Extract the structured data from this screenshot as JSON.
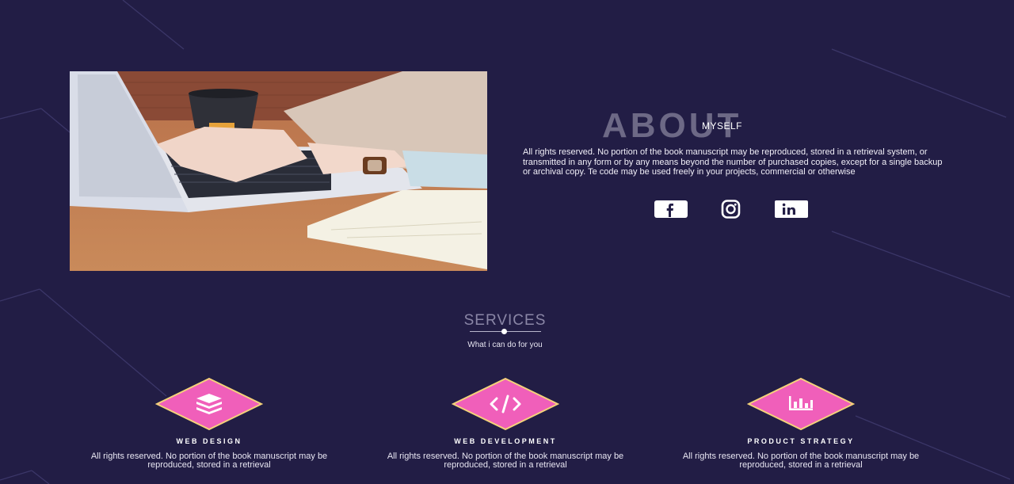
{
  "about": {
    "title": "ABOUT",
    "subtitle": "MYSELF",
    "text": "All rights reserved. No portion of the book manuscript may be reproduced, stored in a retrieval system, or transmitted in any form or by any means beyond the number of purchased copies, except for a single backup or archival copy. Te code may be used freely in your projects, commercial or otherwise"
  },
  "social": [
    {
      "name": "facebook-icon"
    },
    {
      "name": "instagram-icon"
    },
    {
      "name": "linkedin-icon"
    }
  ],
  "services": {
    "title": "SERVICES",
    "subtitle": "What i can do for you",
    "items": [
      {
        "name": "WEB DESIGN",
        "icon": "layers-icon",
        "desc": "All rights reserved. No portion of the book manuscript may be reproduced, stored in a retrieval"
      },
      {
        "name": "WEB DEVELOPMENT",
        "icon": "code-icon",
        "desc": "All rights reserved. No portion of the book manuscript may be reproduced, stored in a retrieval"
      },
      {
        "name": "PRODUCT STRATEGY",
        "icon": "chart-icon",
        "desc": "All rights reserved. No portion of the book manuscript may be reproduced, stored in a retrieval"
      }
    ]
  },
  "colors": {
    "background": "#221d45",
    "accent": "#f05fba",
    "accent_border": "#f4d27a"
  }
}
